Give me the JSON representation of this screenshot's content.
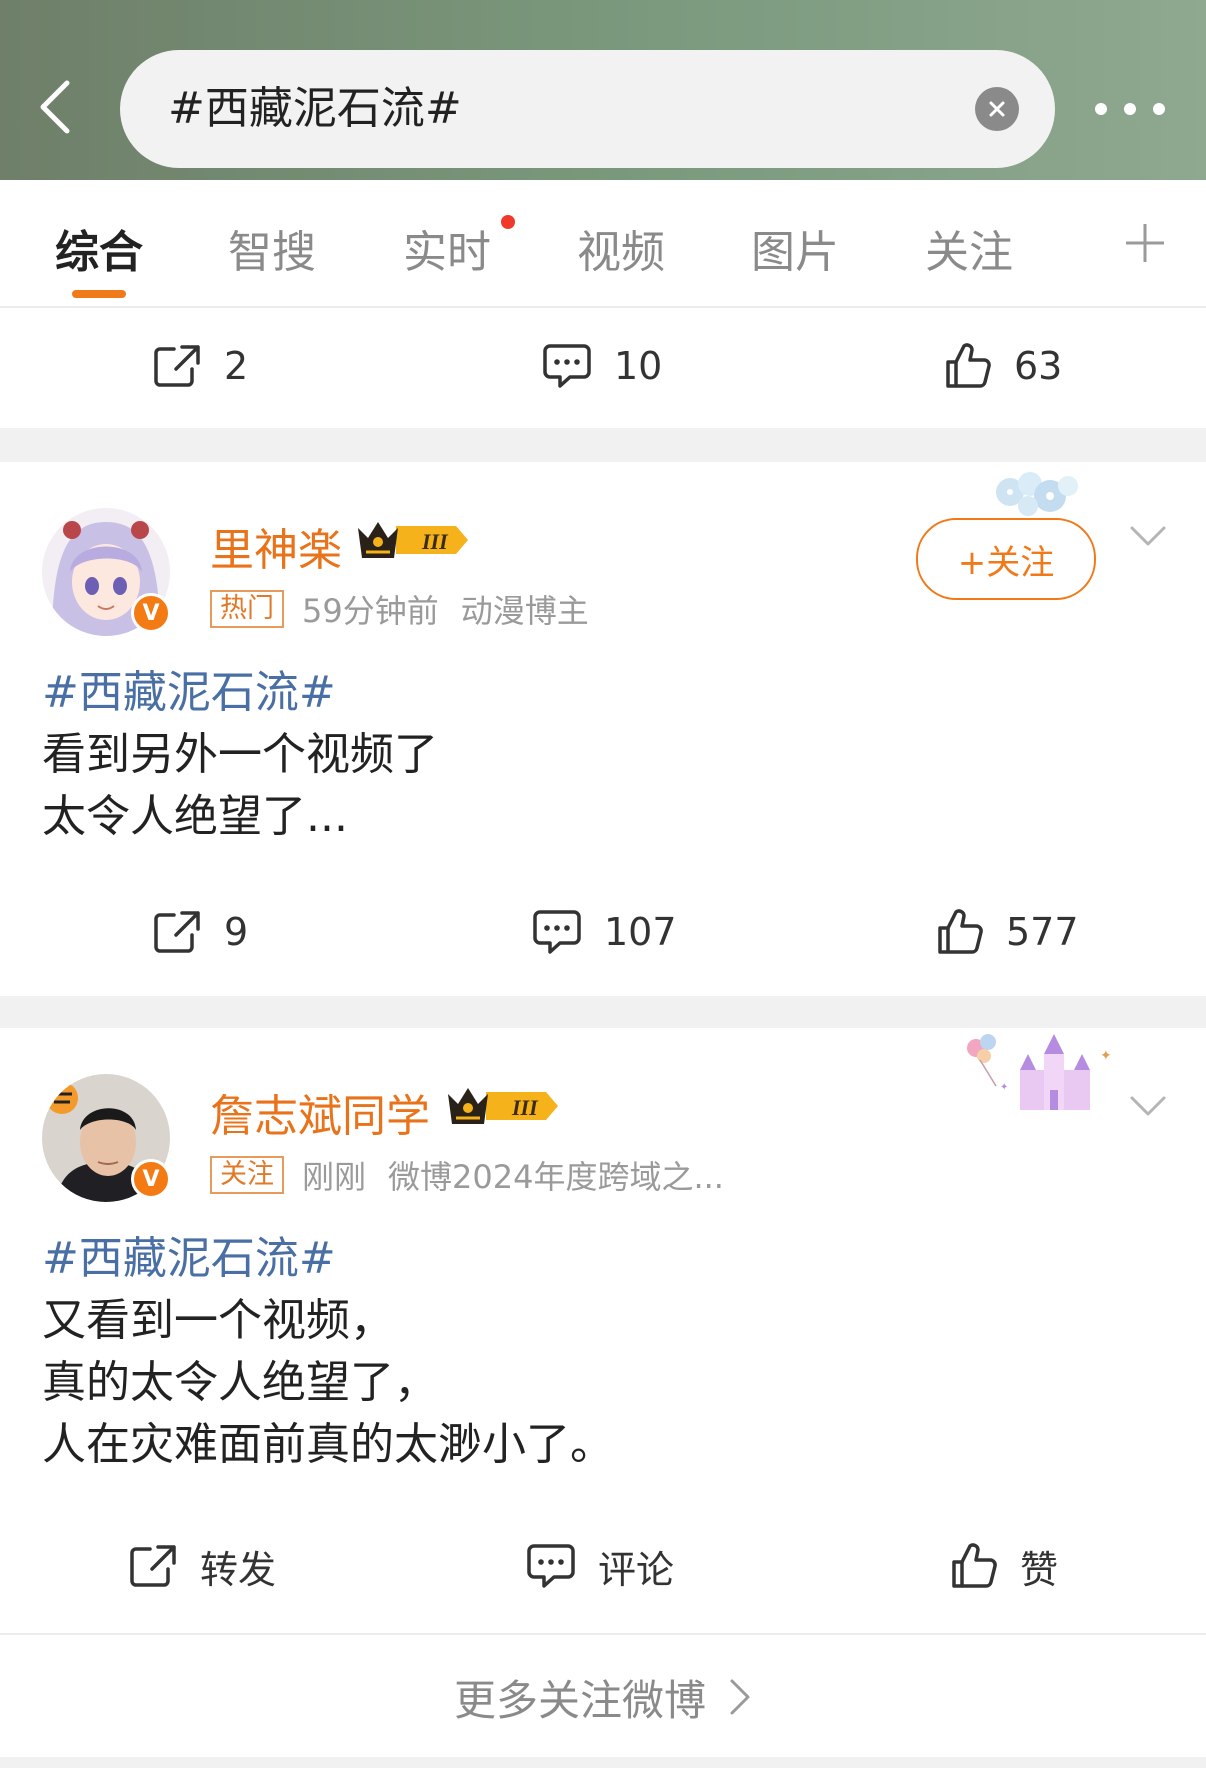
{
  "search": {
    "query": "#西藏泥石流#"
  },
  "tabs": [
    {
      "label": "综合"
    },
    {
      "label": "智搜"
    },
    {
      "label": "实时"
    },
    {
      "label": "视频"
    },
    {
      "label": "图片"
    },
    {
      "label": "关注"
    }
  ],
  "prev_post": {
    "reposts": "2",
    "comments": "10",
    "likes": "63"
  },
  "posts": [
    {
      "username": "里神楽",
      "badge_level": "III",
      "tag": "热门",
      "time": "59分钟前",
      "description": "动漫博主",
      "follow_label": "+关注",
      "hashtag": "#西藏泥石流#",
      "lines": [
        "看到另外一个视频了",
        "太令人绝望了..."
      ],
      "reposts": "9",
      "comments": "107",
      "likes": "577"
    },
    {
      "username": "詹志斌同学",
      "badge_level": "III",
      "tag": "关注",
      "time": "刚刚",
      "description": "微博2024年度跨域之...",
      "hashtag": "#西藏泥石流#",
      "lines": [
        "又看到一个视频，",
        "真的太令人绝望了，",
        "人在灾难面前真的太渺小了。"
      ],
      "reposts": "转发",
      "comments": "评论",
      "likes": "赞"
    }
  ],
  "more_link": "更多关注微博",
  "colors": {
    "accent": "#f07a1a",
    "hashtag": "#4a6fa5",
    "header_bg": "#7b9a7e"
  },
  "icons": [
    "back-arrow-icon",
    "clear-icon",
    "more-icon",
    "plus-icon",
    "repost-icon",
    "comment-icon",
    "like-icon",
    "chevron-down-icon",
    "chevron-right-icon",
    "verified-v-icon",
    "crown-badge-icon"
  ]
}
